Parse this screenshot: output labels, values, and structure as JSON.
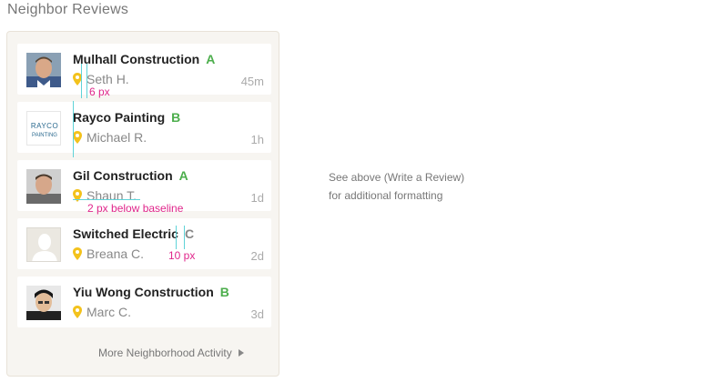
{
  "section_title": "Neighbor Reviews",
  "reviews": [
    {
      "business": "Mulhall Construction",
      "grade": "A",
      "reviewer": "Seth H.",
      "time": "45m",
      "avatar": "person-photo"
    },
    {
      "business": "Rayco Painting",
      "grade": "B",
      "reviewer": "Michael R.",
      "time": "1h",
      "avatar": "company-logo",
      "logo_line1": "RAYCO",
      "logo_line2": "PAINTING"
    },
    {
      "business": "Gil Construction",
      "grade": "A",
      "reviewer": "Shaun T.",
      "time": "1d",
      "avatar": "person-photo"
    },
    {
      "business": "Switched Electric",
      "grade": "C",
      "reviewer": "Breana C.",
      "time": "2d",
      "avatar": "default-avatar"
    },
    {
      "business": "Yiu Wong Construction",
      "grade": "B",
      "reviewer": "Marc C.",
      "time": "3d",
      "avatar": "person-photo"
    }
  ],
  "more_link": "More Neighborhood Activity",
  "side_note": {
    "line1": "See above (Write a Review)",
    "line2": "for additional formatting"
  },
  "annotations": {
    "a1": "6 px",
    "a2": "2 px below baseline",
    "a3": "10 px"
  },
  "colors": {
    "grade": "#4cae4c",
    "pin": "#f3c21c",
    "annotation": "#e0268b",
    "guide": "#5fd3d8",
    "panel_bg": "#f7f5f1"
  }
}
